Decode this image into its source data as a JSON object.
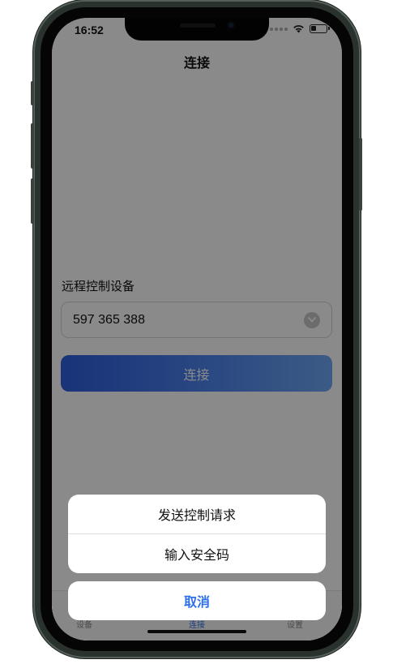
{
  "status_bar": {
    "time": "16:52"
  },
  "nav": {
    "title": "连接"
  },
  "form": {
    "section_label": "远程控制设备",
    "device_id": "597 365 388",
    "connect_label": "连接"
  },
  "tabs": [
    {
      "label": "设备"
    },
    {
      "label": "连接"
    },
    {
      "label": "设置"
    }
  ],
  "action_sheet": {
    "items": [
      {
        "label": "发送控制请求"
      },
      {
        "label": "输入安全码"
      }
    ],
    "cancel_label": "取消"
  },
  "colors": {
    "accent": "#2f6fe8",
    "overlay": "rgba(0,0,0,0.46)",
    "frame": "#2a322e"
  },
  "icons": [
    "wifi-icon",
    "battery-icon",
    "chevron-down-icon"
  ]
}
